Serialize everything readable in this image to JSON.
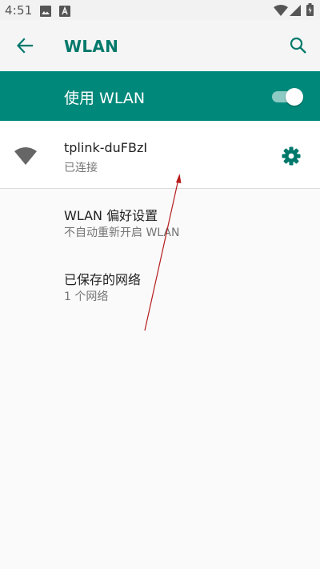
{
  "status_bar": {
    "time": "4:51",
    "left_icons": [
      "image-icon",
      "a-icon"
    ],
    "right_icons": [
      "wifi-icon",
      "signal-icon",
      "battery-icon"
    ]
  },
  "app_bar": {
    "title": "WLAN",
    "back_icon": "arrow-left-icon",
    "search_icon": "search-icon"
  },
  "master_switch": {
    "label": "使用 WLAN",
    "state": "on"
  },
  "connected_network": {
    "ssid": "tplink-duFBzI",
    "status": "已连接",
    "signal_icon": "wifi-signal-icon",
    "settings_icon": "gear-icon"
  },
  "preferences": [
    {
      "title": "WLAN 偏好设置",
      "subtitle": "不自动重新开启 WLAN"
    },
    {
      "title": "已保存的网络",
      "subtitle": "1 个网络"
    }
  ],
  "colors": {
    "accent": "#00796b",
    "master_bar": "#00897b",
    "annotation": "#b71c1c"
  }
}
